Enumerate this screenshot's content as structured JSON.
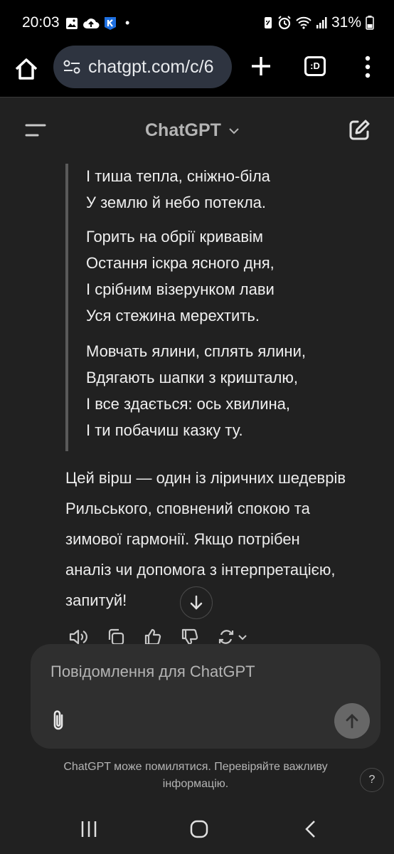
{
  "status_bar": {
    "time": "20:03",
    "battery": "31%",
    "dot": "•",
    "icons": [
      "gallery-icon",
      "cloud-upload-icon",
      "k-app-icon",
      "nfc-icon",
      "alarm-icon",
      "wifi-icon",
      "signal-icon",
      "battery-icon"
    ]
  },
  "browser": {
    "url": "chatgpt.com/c/6",
    "tabs_label": ":D"
  },
  "chat_header": {
    "title": "ChatGPT"
  },
  "message": {
    "stanzas": [
      [
        "І тиша тепла, сніжно-біла",
        "У землю й небо потекла."
      ],
      [
        "Горить на обрії кривавім",
        "Остання іскра ясного дня,",
        "І срібним візерунком лави",
        "Уся стежина мерехтить."
      ],
      [
        "Мовчать ялини, сплять ялини,",
        "Вдягають шапки з кришталю,",
        "І все здається: ось хвилина,",
        "І ти побачиш казку ту."
      ]
    ],
    "paragraph_lines": [
      "Цей вірш — один із ліричних шедеврів",
      "Рильського, сповнений спокою та",
      "зимової гармонії. Якщо потрібен",
      "аналіз чи допомога з інтерпретацією,",
      "запитуй!"
    ]
  },
  "composer": {
    "placeholder": "Повідомлення для ChatGPT"
  },
  "disclaimer": {
    "line1": "ChatGPT може помилятися. Перевіряйте важливу",
    "line2": "інформацію."
  },
  "help_label": "?"
}
